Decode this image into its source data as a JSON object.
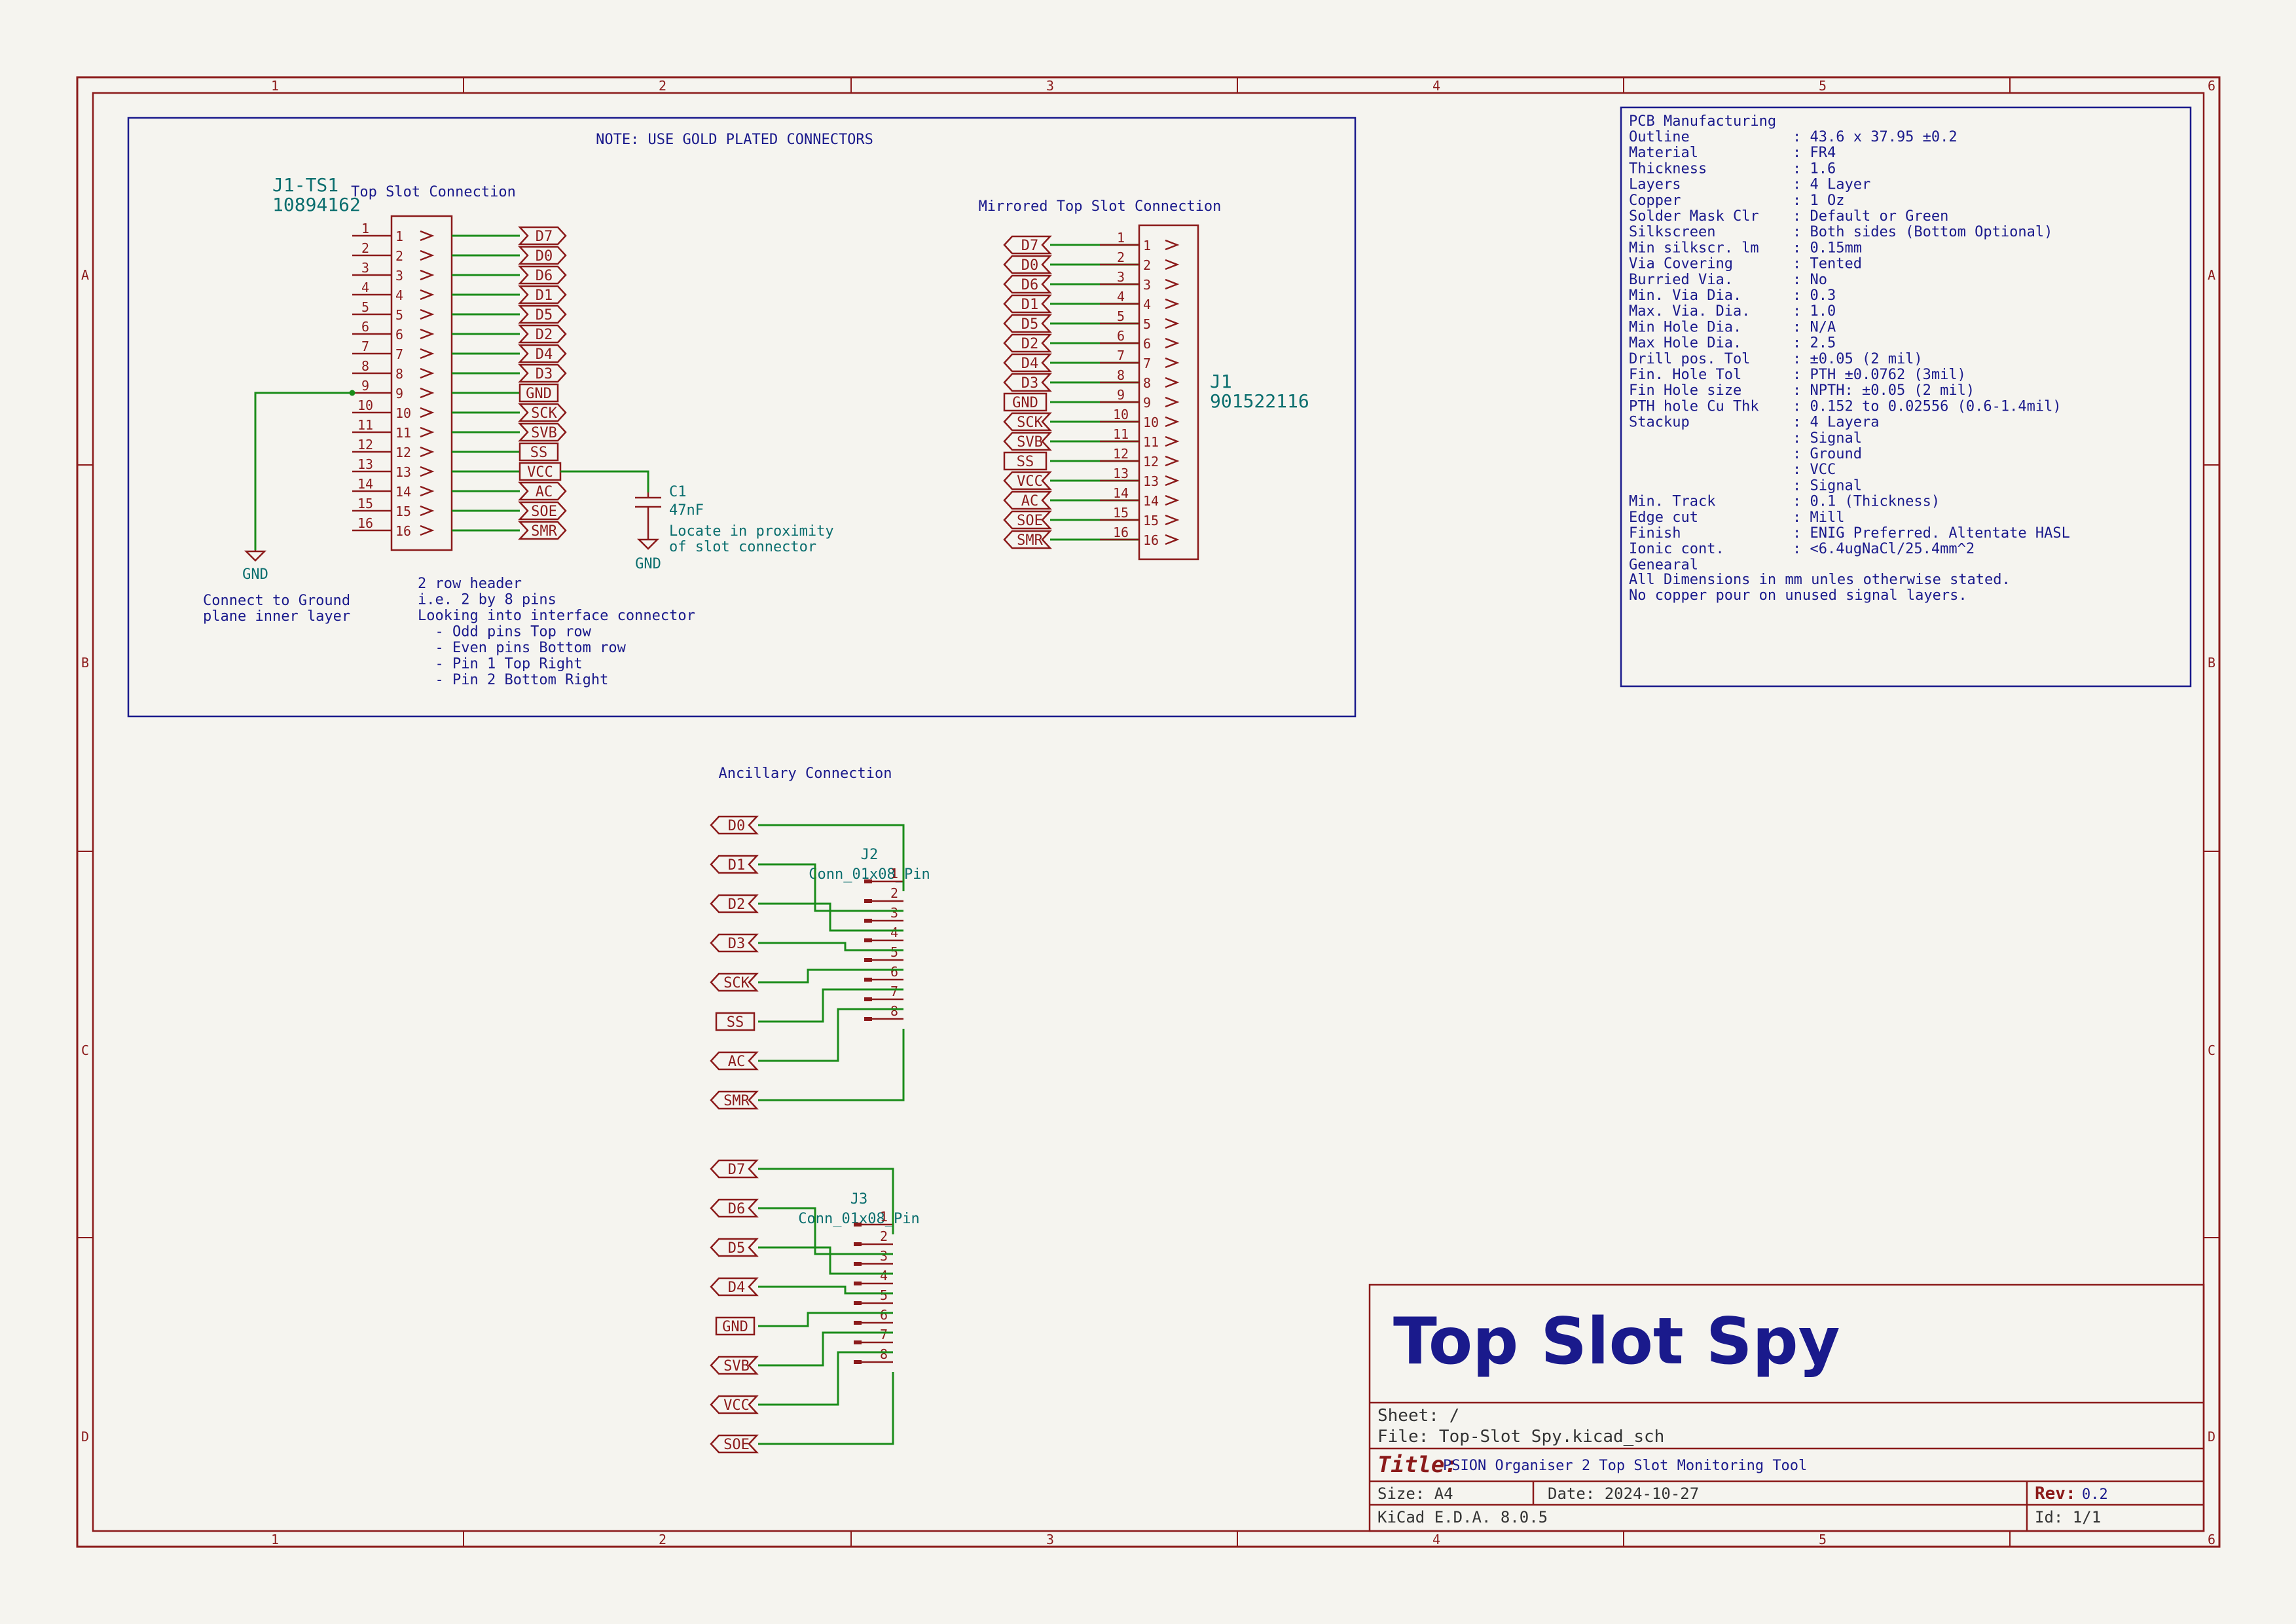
{
  "frame": {
    "cols": [
      "1",
      "2",
      "3",
      "4",
      "5",
      "6"
    ],
    "rows": [
      "A",
      "B",
      "C",
      "D"
    ]
  },
  "notes": {
    "gold": "NOTE: USE GOLD PLATED CONNECTORS",
    "top_slot_title": "Top Slot Connection",
    "mirrored_title": "Mirrored Top Slot Connection",
    "ancillary_title": "Ancillary Connection",
    "ground_note": [
      "Connect to Ground",
      "plane inner layer"
    ],
    "header_note": [
      "2 row header",
      "i.e. 2 by 8 pins",
      "Looking into interface connector",
      "  - Odd pins Top row",
      "  - Even pins Bottom row",
      "  - Pin 1 Top Right",
      "  - Pin 2 Bottom Right"
    ],
    "cap_note": [
      "Locate in proximity",
      "of slot connector"
    ]
  },
  "components": {
    "j1ts1": {
      "ref": "J1-TS1",
      "value": "10894162"
    },
    "j1": {
      "ref": "J1",
      "value": "901522116"
    },
    "c1": {
      "ref": "C1",
      "value": "47nF"
    },
    "j2": {
      "ref": "J2",
      "value": "Conn_01x08_Pin"
    },
    "j3": {
      "ref": "J3",
      "value": "Conn_01x08_Pin"
    },
    "gnd_label": "GND"
  },
  "pin_numbers": [
    "1",
    "2",
    "3",
    "4",
    "5",
    "6",
    "7",
    "8",
    "9",
    "10",
    "11",
    "12",
    "13",
    "14",
    "15",
    "16"
  ],
  "short_pins": [
    "1",
    "2",
    "3",
    "4",
    "5",
    "6",
    "7",
    "8"
  ],
  "top_slot_labels": [
    "D7",
    "D0",
    "D6",
    "D1",
    "D5",
    "D2",
    "D4",
    "D3",
    "GND",
    "SCK",
    "SVB",
    "SS",
    "VCC",
    "AC",
    "SOE",
    "SMR"
  ],
  "j2_labels": [
    "D0",
    "D1",
    "D2",
    "D3",
    "SCK",
    "SS",
    "AC",
    "SMR"
  ],
  "j3_labels": [
    "D7",
    "D6",
    "D5",
    "D4",
    "GND",
    "SVB",
    "VCC",
    "SOE"
  ],
  "pcb_manufacturing": {
    "title": "PCB Manufacturing",
    "rows": [
      {
        "key": "Outline",
        "value": ": 43.6 x 37.95 ±0.2"
      },
      {
        "key": "Material",
        "value": ": FR4"
      },
      {
        "key": "Thickness",
        "value": ": 1.6"
      },
      {
        "key": "Layers",
        "value": ": 4 Layer"
      },
      {
        "key": "Copper",
        "value": ": 1 Oz"
      },
      {
        "key": "Solder Mask Clr",
        "value": ": Default or Green"
      },
      {
        "key": "Silkscreen",
        "value": ": Both sides (Bottom Optional)"
      },
      {
        "key": "Min silkscr. lm",
        "value": ": 0.15mm"
      },
      {
        "key": "Via Covering",
        "value": ": Tented"
      },
      {
        "key": "Burried Via.",
        "value": ": No"
      },
      {
        "key": "Min. Via Dia.",
        "value": ": 0.3"
      },
      {
        "key": "Max. Via. Dia.",
        "value": ": 1.0"
      },
      {
        "key": "Min Hole Dia.",
        "value": ": N/A"
      },
      {
        "key": "Max Hole Dia.",
        "value": ": 2.5"
      },
      {
        "key": "Drill pos. Tol",
        "value": ": ±0.05 (2 mil)"
      },
      {
        "key": "Fin. Hole Tol",
        "value": ": PTH ±0.0762 (3mil)"
      },
      {
        "key": "Fin Hole size",
        "value": ": NPTH: ±0.05 (2 mil)"
      },
      {
        "key": "PTH hole Cu Thk",
        "value": ": 0.152 to 0.02556 (0.6-1.4mil)"
      },
      {
        "key": "Stackup",
        "value": ": 4 Layera"
      },
      {
        "key": "",
        "value": ": Signal"
      },
      {
        "key": "",
        "value": ": Ground"
      },
      {
        "key": "",
        "value": ": VCC"
      },
      {
        "key": "",
        "value": ": Signal"
      },
      {
        "key": "Min. Track",
        "value": ": 0.1 (Thickness)"
      },
      {
        "key": "Edge cut",
        "value": ": Mill"
      },
      {
        "key": "Finish",
        "value": ": ENIG Preferred. Altentate HASL"
      },
      {
        "key": "Ionic cont.",
        "value": ": <6.4ugNaCl/25.4mm^2"
      },
      {
        "key": "Genearal",
        "value": ""
      }
    ],
    "footer": [
      "All Dimensions in mm unles otherwise stated.",
      "No copper pour on unused signal layers."
    ]
  },
  "title_block": {
    "title": "Top Slot Spy",
    "sheet": "Sheet: /",
    "file": "File: Top-Slot Spy.kicad_sch",
    "title_label": "Title:",
    "title_value": "PSION Organiser 2 Top Slot Monitoring Tool",
    "size": "Size: A4",
    "date": "Date: 2024-10-27",
    "rev_label": "Rev:",
    "rev_value": "0.2",
    "tool": "KiCad E.D.A. 8.0.5",
    "id": "Id: 1/1"
  }
}
